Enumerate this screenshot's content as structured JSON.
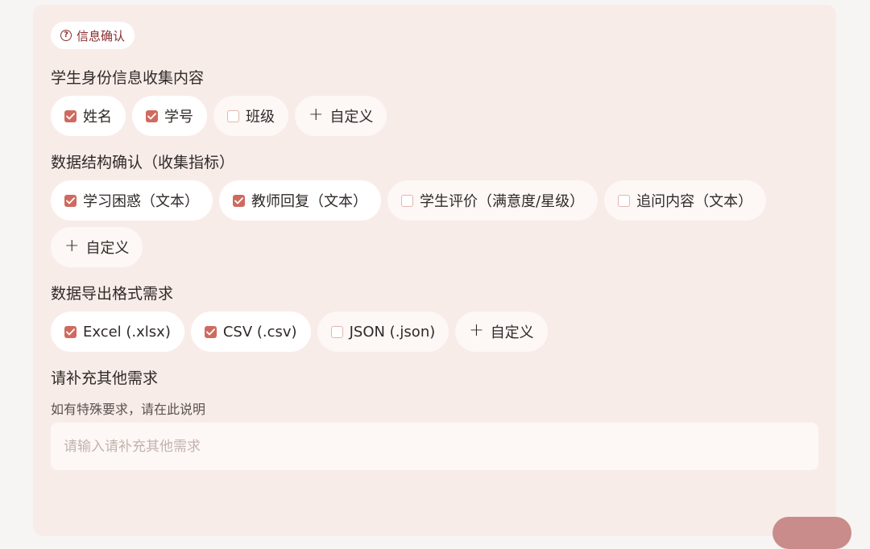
{
  "badge": {
    "label": "信息确认",
    "icon": "question-circle-icon"
  },
  "sections": [
    {
      "title": "学生身份信息收集内容",
      "options": [
        {
          "label": "姓名",
          "checked": true
        },
        {
          "label": "学号",
          "checked": true
        },
        {
          "label": "班级",
          "checked": false
        }
      ],
      "custom_label": "自定义"
    },
    {
      "title": "数据结构确认（收集指标）",
      "options": [
        {
          "label": "学习困惑（文本）",
          "checked": true
        },
        {
          "label": "教师回复（文本）",
          "checked": true
        },
        {
          "label": "学生评价（满意度/星级）",
          "checked": false
        },
        {
          "label": "追问内容（文本）",
          "checked": false
        }
      ],
      "custom_label": "自定义"
    },
    {
      "title": "数据导出格式需求",
      "options": [
        {
          "label": "Excel (.xlsx)",
          "checked": true
        },
        {
          "label": "CSV (.csv)",
          "checked": true
        },
        {
          "label": "JSON (.json)",
          "checked": false
        }
      ],
      "custom_label": "自定义"
    }
  ],
  "extra": {
    "title": "请补充其他需求",
    "hint": "如有特殊要求，请在此说明",
    "placeholder": "请输入请补充其他需求",
    "value": ""
  },
  "colors": {
    "panel_bg": "#f8ece9",
    "accent": "#cf6a5f",
    "badge_text": "#8b2f2f"
  }
}
